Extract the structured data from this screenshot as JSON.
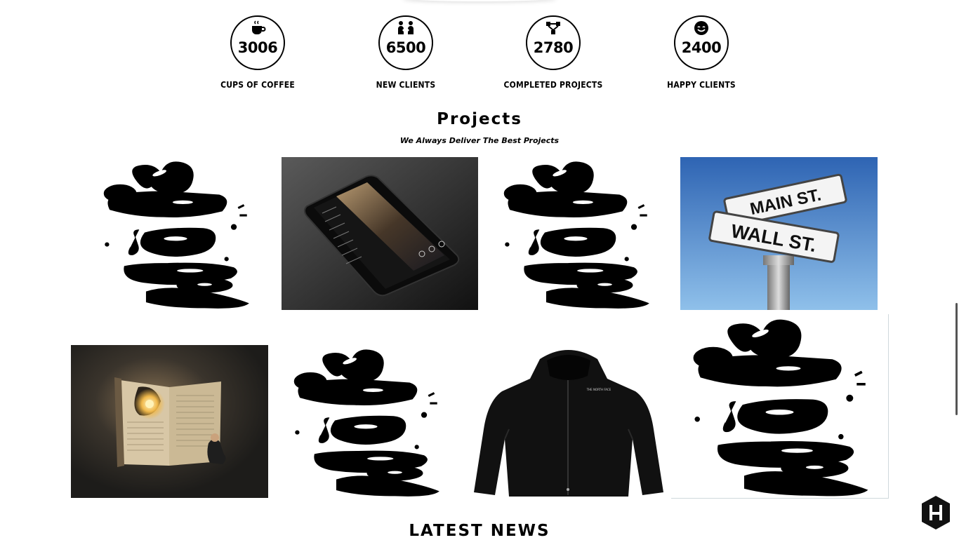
{
  "stats": [
    {
      "number": "3006",
      "label": "CUPS OF COFFEE",
      "icon": "coffee-cup-icon"
    },
    {
      "number": "6500",
      "label": "NEW CLIENTS",
      "icon": "people-exchange-icon"
    },
    {
      "number": "2780",
      "label": "COMPLETED PROJECTS",
      "icon": "project-tree-icon"
    },
    {
      "number": "2400",
      "label": "HAPPY CLIENTS",
      "icon": "smiley-face-icon"
    }
  ],
  "projects": {
    "title": "Projects",
    "subtitle": "We Always Deliver The Best Projects",
    "items": [
      {
        "image": "love-lettering-art"
      },
      {
        "image": "phone-mockup"
      },
      {
        "image": "love-lettering-art"
      },
      {
        "image": "street-sign",
        "sign_top": "MAIN ST.",
        "sign_bottom": "WALL ST."
      },
      {
        "image": "book-light-art"
      },
      {
        "image": "love-lettering-art"
      },
      {
        "image": "black-jacket",
        "brand": "THE NORTH FACE"
      },
      {
        "image": "love-lettering-art"
      }
    ]
  },
  "news": {
    "title": "LATEST NEWS"
  },
  "fab": {
    "icon": "hexagon-h-icon"
  },
  "colors": {
    "text": "#000000",
    "sky_top": "#2e64b3",
    "sky_bottom": "#8fc0ea",
    "dark_tile": "#2a2a2a"
  }
}
